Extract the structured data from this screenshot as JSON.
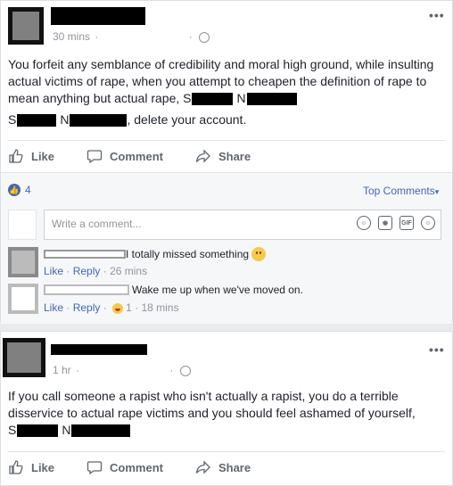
{
  "post1": {
    "time": "30 mins",
    "dot": "·",
    "more": "•••",
    "paragraph1_text": "You forfeit any semblance of credibility and moral high ground, while insulting actual victims of rape, when you attempt to cheapen the definition of rape to mean anything but actual rape, S",
    "p1_n": "N",
    "p2_s": "S",
    "p2_n": "N",
    "p2_rest": ", delete your account.",
    "actions": {
      "like": "Like",
      "comment": "Comment",
      "share": "Share"
    },
    "likes_count": "4",
    "top_comments": "Top Comments",
    "top_caret": "▾",
    "composer_placeholder": "Write a comment...",
    "gif": "GIF",
    "comments": [
      {
        "text": "I totally missed something",
        "like": "Like",
        "reply": "Reply",
        "sep": "·",
        "time": "26 mins"
      },
      {
        "text": "Wake me up when we've moved on.",
        "like": "Like",
        "reply": "Reply",
        "sep": "·",
        "reactions": "1",
        "time": "18 mins"
      }
    ]
  },
  "post2": {
    "time": "1 hr",
    "dot": "·",
    "more": "•••",
    "text": "If you call someone a rapist who isn't actually a rapist, you do a terrible disservice to actual rape victims and you should feel ashamed of yourself,",
    "s": "S",
    "n": "N",
    "actions": {
      "like": "Like",
      "comment": "Comment",
      "share": "Share"
    }
  },
  "colors": {
    "link": "#4267b2",
    "muted": "#90949c",
    "action": "#606770"
  }
}
